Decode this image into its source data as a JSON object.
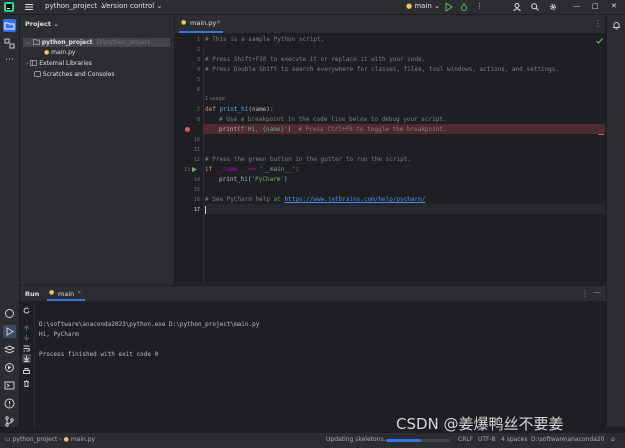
{
  "titlebar": {
    "project_name": "python_project",
    "vcs_label": "Version control",
    "run_config": "main"
  },
  "project_panel": {
    "title": "Project",
    "tree": [
      {
        "label": "python_project",
        "hint": "D:\\python_project"
      },
      {
        "label": "main.py"
      },
      {
        "label": "External Libraries"
      },
      {
        "label": "Scratches and Consoles"
      }
    ]
  },
  "editor": {
    "tab_label": "main.py",
    "inlay_usage": "1 usage",
    "lines": [
      "1",
      "2",
      "3",
      "4",
      "5",
      "6",
      "7",
      "8",
      "9",
      "10",
      "11",
      "12",
      "13",
      "14",
      "15",
      "16",
      "17"
    ],
    "code": {
      "l1": "# This is a sample Python script.",
      "l3": "# Press Shift+F10 to execute it or replace it with your code.",
      "l4": "# Press Double Shift to search everywhere for classes, files, tool windows, actions, and settings.",
      "l7_kw": "def ",
      "l7_fn": "print_hi",
      "l7_rest": "(name):",
      "l8": "# Use a breakpoint in the code line below to debug your script.",
      "l9_a": "print(",
      "l9_str": "f'Hi, {name}'",
      "l9_b": ")  ",
      "l9_cm": "# Press Ctrl+F8 to toggle the breakpoint.",
      "l12": "# Press the green button in the gutter to run the script.",
      "l13_kw": "if ",
      "l13_a": "__name__ == ",
      "l13_str": "'__main__'",
      "l13_b": ":",
      "l14_a": "print_hi(",
      "l14_str": "'PyCharm'",
      "l14_b": ")",
      "l16_cm": "# See PyCharm help at ",
      "l16_link": "https://www.jetbrains.com/help/pycharm/"
    }
  },
  "run_panel": {
    "title": "Run",
    "tab_label": "main",
    "console": [
      "D:\\software\\anaconda2023\\python.exe D:\\python_project\\main.py",
      "Hi, PyCharm",
      "",
      "Process finished with exit code 0"
    ]
  },
  "statusbar": {
    "breadcrumb_project": "python_project",
    "breadcrumb_file": "main.py",
    "progress_text": "Updating skeletons...",
    "progress_fraction": 0.55,
    "line_sep": "CRLF",
    "encoding": "UTF-8",
    "indent": "4 spaces",
    "interpreter": "D:\\software\\anaconda2023"
  },
  "watermark": "CSDN @姜爆鸭丝不要姜",
  "colors": {
    "accent_green": "#5fb865",
    "breakpoint_red": "#db5c5c",
    "folder_blue": "#548af7"
  }
}
